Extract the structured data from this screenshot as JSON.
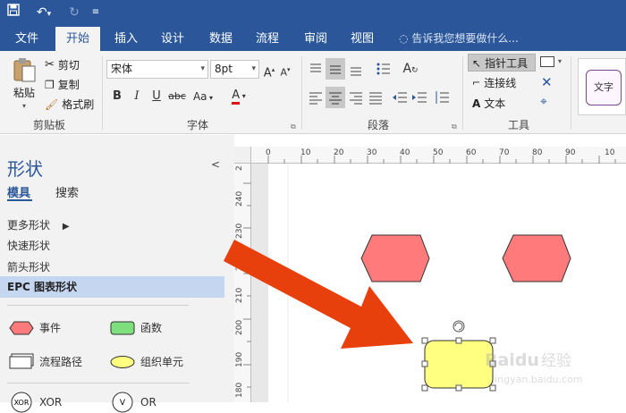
{
  "quick_access": {
    "save_icon": "save-icon",
    "undo_icon": "undo-icon",
    "redo_icon": "redo-icon",
    "customize_icon": "customize-qat-icon"
  },
  "tabs": {
    "file": "文件",
    "home": "开始",
    "insert": "插入",
    "design": "设计",
    "data": "数据",
    "process": "流程",
    "review": "审阅",
    "view": "视图",
    "tell_me": "告诉我您想要做什么..."
  },
  "clipboard": {
    "paste": "粘贴",
    "cut": "剪切",
    "copy": "复制",
    "format_painter": "格式刷",
    "label": "剪贴板"
  },
  "font": {
    "name": "宋体",
    "size": "8pt",
    "bold": "B",
    "italic": "I",
    "underline": "U",
    "strikethrough": "abc",
    "case": "Aa",
    "font_color": "A",
    "grow": "A",
    "shrink": "A",
    "label": "字体"
  },
  "paragraph": {
    "label": "段落"
  },
  "tools": {
    "pointer": "指针工具",
    "connector": "连接线",
    "text": "文本",
    "label": "工具",
    "text_style": "文字"
  },
  "shapes_pane": {
    "title": "形状",
    "tab_stencils": "模具",
    "tab_search": "搜索",
    "more_shapes": "更多形状",
    "quick_shapes": "快速形状",
    "arrow_shapes": "箭头形状",
    "epc_shapes": "EPC 图表形状",
    "stencils": [
      {
        "label": "事件",
        "icon": "event-hexagon-icon",
        "color": "#ff7b7b"
      },
      {
        "label": "函数",
        "icon": "function-rounded-rect-icon",
        "color": "#7de07d"
      },
      {
        "label": "流程路径",
        "icon": "process-path-icon",
        "color": "#ffffff"
      },
      {
        "label": "组织单元",
        "icon": "organization-unit-ellipse-icon",
        "color": "#ffff80"
      },
      {
        "label": "XOR",
        "icon": "xor-circle-icon",
        "color": "#ffffff"
      },
      {
        "label": "OR",
        "icon": "or-circle-icon",
        "color": "#ffffff"
      }
    ]
  },
  "ruler": {
    "top_labels": [
      "0",
      "10",
      "20",
      "30",
      "40",
      "50",
      "60",
      "70",
      "80",
      "90",
      "10"
    ],
    "left_labels": [
      "2",
      "240",
      "230",
      "220",
      "210",
      "200",
      "190",
      "180"
    ]
  },
  "canvas": {
    "event_color": "#ff7b7b",
    "selected_shape_color": "#ffff80",
    "arrow_color": "#e8400c"
  },
  "watermark": "Baidu经验 jingyan.baidu.com"
}
